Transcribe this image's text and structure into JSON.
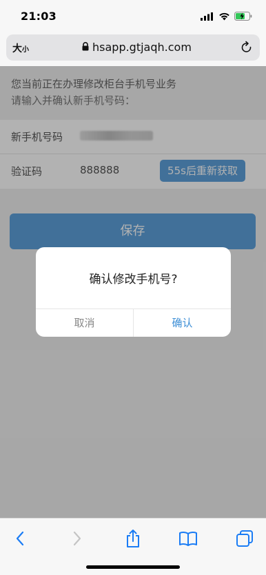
{
  "status_bar": {
    "time": "21:03",
    "icons": [
      "cellular-signal-icon",
      "wifi-icon",
      "battery-charging-icon"
    ]
  },
  "address_bar": {
    "text_size_label_big": "大",
    "text_size_label_small": "小",
    "url": "hsapp.gtjaqh.com",
    "lock_icon": "lock-icon",
    "reload_icon": "reload-icon"
  },
  "page": {
    "intro_line1": "您当前正在办理修改柜台手机号业务",
    "intro_line2": "请输入并确认新手机号码：",
    "phone_label": "新手机号码",
    "code_label": "验证码",
    "code_value": "888888",
    "resend_button": "55s后重新获取",
    "save_button": "保存"
  },
  "dialog": {
    "message": "确认修改手机号?",
    "cancel": "取消",
    "confirm": "确认"
  },
  "toolbar": {
    "icons": [
      "back-icon",
      "forward-icon",
      "share-icon",
      "bookmarks-icon",
      "tabs-icon"
    ]
  },
  "colors": {
    "accent": "#5ea1db",
    "dialog_confirm": "#3e8fd6",
    "ios_blue": "#1a7cf5"
  }
}
